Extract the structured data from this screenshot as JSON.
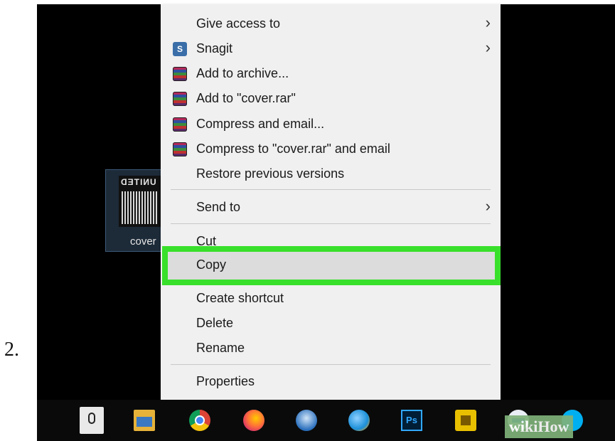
{
  "step_number": "2.",
  "desktop": {
    "file": {
      "label": "cover",
      "thumbnail_text": "UNITED"
    }
  },
  "context_menu": {
    "items": [
      {
        "label": "Give access to",
        "icon": "",
        "submenu": true
      },
      {
        "label": "Snagit",
        "icon": "snagit-icon",
        "submenu": true
      },
      {
        "label": "Add to archive...",
        "icon": "winrar-icon",
        "submenu": false
      },
      {
        "label": "Add to \"cover.rar\"",
        "icon": "winrar-icon",
        "submenu": false
      },
      {
        "label": "Compress and email...",
        "icon": "winrar-icon",
        "submenu": false
      },
      {
        "label": "Compress to \"cover.rar\" and email",
        "icon": "winrar-icon",
        "submenu": false
      },
      {
        "label": "Restore previous versions",
        "icon": "",
        "submenu": false
      },
      {
        "label": "Send to",
        "icon": "",
        "submenu": true
      },
      {
        "label": "Cut",
        "icon": "",
        "submenu": false
      },
      {
        "label": "Copy",
        "icon": "",
        "submenu": false,
        "highlighted": true
      },
      {
        "label": "Create shortcut",
        "icon": "",
        "submenu": false
      },
      {
        "label": "Delete",
        "icon": "",
        "submenu": false
      },
      {
        "label": "Rename",
        "icon": "",
        "submenu": false
      },
      {
        "label": "Properties",
        "icon": "",
        "submenu": false
      }
    ],
    "submenu_arrow": "›",
    "highlight_color": "#39e02b"
  },
  "taskbar": {
    "icons": [
      "microphone-icon",
      "file-explorer-icon",
      "chrome-icon",
      "firefox-icon",
      "thunderbird-icon",
      "internet-explorer-icon",
      "photoshop-icon",
      "puzzle-app-icon",
      "teamviewer-icon",
      "skype-icon"
    ],
    "photoshop_text": "Ps"
  },
  "watermark": "wikiHow"
}
